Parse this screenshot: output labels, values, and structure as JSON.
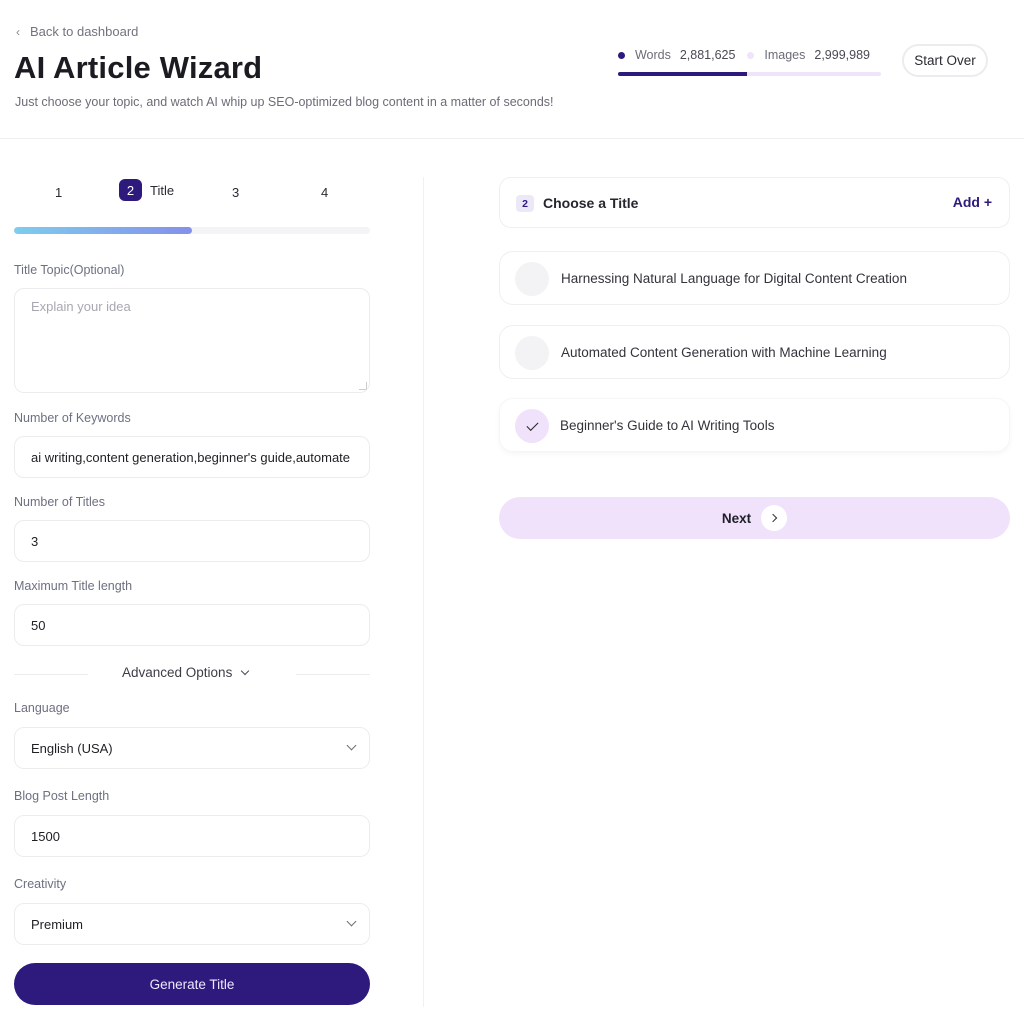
{
  "header": {
    "back_label": "Back to dashboard",
    "title": "AI Article Wizard",
    "subtitle": "Just choose your topic, and watch AI whip up SEO-optimized blog content in a matter of seconds!",
    "start_over_label": "Start Over"
  },
  "usage": {
    "words_label": "Words",
    "words_value": "2,881,625",
    "images_label": "Images",
    "images_value": "2,999,989",
    "words_share_percent": 49,
    "colors": {
      "words": "#2e1a7c",
      "images": "#f0e4fb"
    }
  },
  "wizard": {
    "steps": [
      {
        "number": "1",
        "label": ""
      },
      {
        "number": "2",
        "label": "Title",
        "active": true
      },
      {
        "number": "3",
        "label": ""
      },
      {
        "number": "4",
        "label": ""
      }
    ],
    "progress_percent": 50
  },
  "form": {
    "title_topic": {
      "label": "Title Topic(Optional)",
      "placeholder": "Explain your idea",
      "value": ""
    },
    "keywords": {
      "label": "Number of Keywords",
      "value": "ai writing,content generation,beginner's guide,automate"
    },
    "num_titles": {
      "label": "Number of Titles",
      "value": "3"
    },
    "max_title_length": {
      "label": "Maximum Title length",
      "value": "50"
    },
    "advanced_label": "Advanced Options",
    "language": {
      "label": "Language",
      "value": "English (USA)"
    },
    "blog_length": {
      "label": "Blog Post Length",
      "value": "1500"
    },
    "creativity": {
      "label": "Creativity",
      "value": "Premium"
    },
    "generate_label": "Generate Title"
  },
  "titles_panel": {
    "step_badge": "2",
    "heading": "Choose a Title",
    "add_label": "Add +",
    "options": [
      {
        "text": "Harnessing Natural Language for Digital Content Creation",
        "selected": false
      },
      {
        "text": "Automated Content Generation with Machine Learning",
        "selected": false
      },
      {
        "text": "Beginner's Guide to AI Writing Tools",
        "selected": true
      }
    ],
    "next_label": "Next"
  },
  "colors": {
    "primary": "#2e1a7c",
    "accent_light": "#f1e2fb",
    "progress_start": "#7ecdee",
    "progress_end": "#8590ea"
  }
}
